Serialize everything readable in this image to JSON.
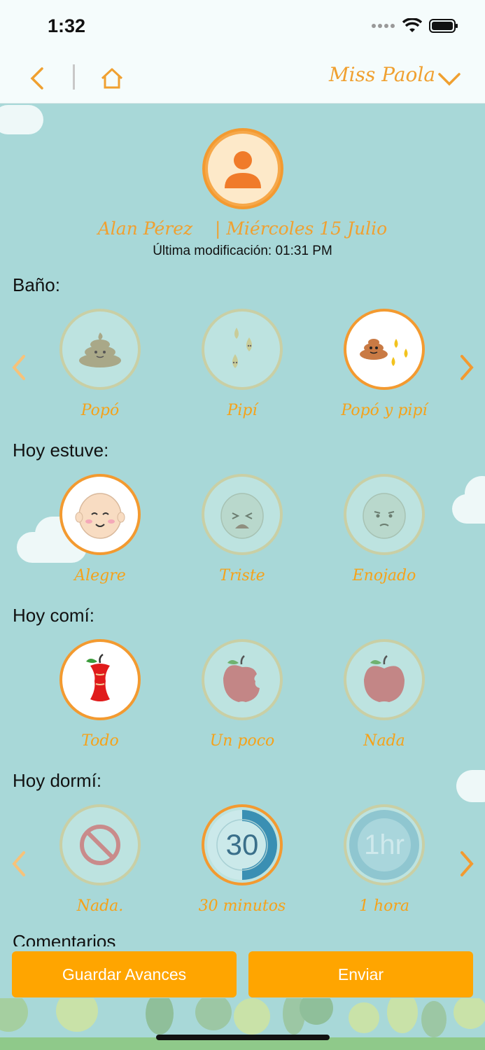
{
  "status": {
    "time": "1:32"
  },
  "nav": {
    "user": "Miss Paola"
  },
  "child": {
    "name": "Alan Pérez",
    "date": "| Miércoles 15 Julio",
    "modified": "Última modificación: 01:31 PM"
  },
  "sections": {
    "bano": {
      "title": "Baño:",
      "options": [
        {
          "label": "Popó",
          "icon": "poop-icon",
          "selected": false
        },
        {
          "label": "Pipí",
          "icon": "pee-drops-icon",
          "selected": false
        },
        {
          "label": "Popó y pipí",
          "icon": "poop-and-pee-icon",
          "selected": true
        }
      ]
    },
    "animo": {
      "title": "Hoy estuve:",
      "options": [
        {
          "label": "Alegre",
          "icon": "happy-face-icon",
          "selected": true
        },
        {
          "label": "Triste",
          "icon": "sad-face-icon",
          "selected": false
        },
        {
          "label": "Enojado",
          "icon": "angry-face-icon",
          "selected": false
        }
      ]
    },
    "comida": {
      "title": "Hoy comí:",
      "options": [
        {
          "label": "Todo",
          "icon": "apple-core-icon",
          "selected": true
        },
        {
          "label": "Un poco",
          "icon": "bitten-apple-icon",
          "selected": false
        },
        {
          "label": "Nada",
          "icon": "whole-apple-icon",
          "selected": false
        }
      ]
    },
    "sueno": {
      "title": "Hoy dormí:",
      "options": [
        {
          "label": "Nada.",
          "icon": "no-sleep-icon",
          "selected": false
        },
        {
          "label": "30 minutos",
          "icon": "timer-30-icon",
          "selected": true,
          "glyph": "30"
        },
        {
          "label": "1 hora",
          "icon": "timer-1hr-icon",
          "selected": false,
          "glyph": "1hr"
        }
      ]
    }
  },
  "next_section_title": "Comentarios",
  "actions": {
    "save": "Guardar Avances",
    "send": "Enviar"
  },
  "colors": {
    "accent": "#f39a30",
    "button": "#ffa500",
    "background": "#a8d8d8"
  }
}
